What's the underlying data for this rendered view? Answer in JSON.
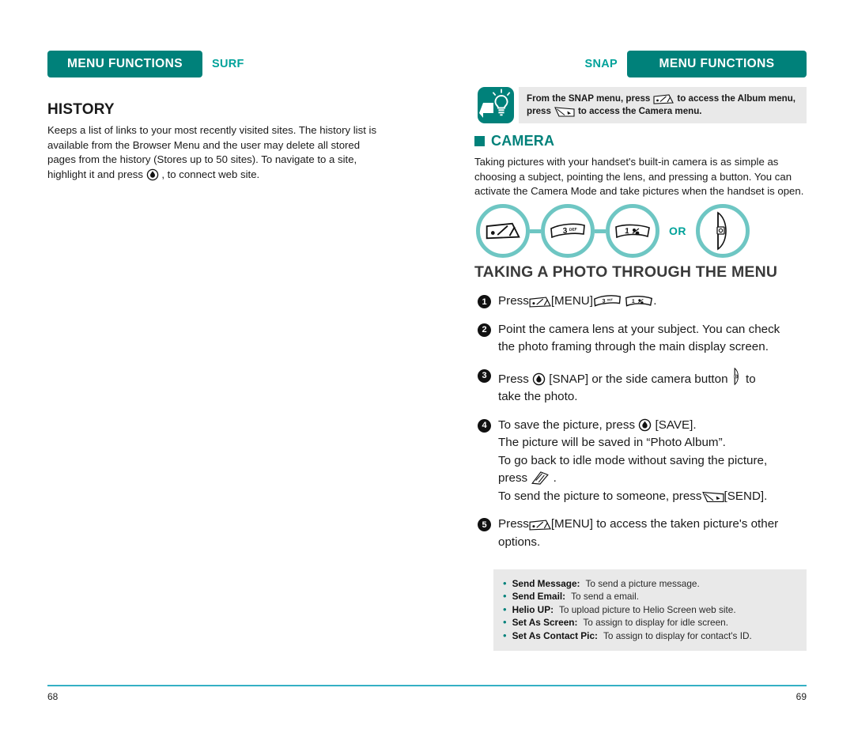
{
  "colors": {
    "teal_dark": "#00817a",
    "teal_mid": "#00a29a",
    "teal_ring": "#6ec6c3",
    "rule": "#35b0c4",
    "box_gray": "#e9e9e9",
    "text": "#1a1a1a"
  },
  "left_page": {
    "badge": "MENU FUNCTIONS",
    "section_tag": "SURF",
    "heading": "HISTORY",
    "body": "Keeps a list of links to your most recently visited sites. The history list is available from the Browser Menu and the user may delete all stored pages from the history (Stores up to 50 sites). To navigate to a site, highlight it and press",
    "body_tail": ", to connect web site.",
    "page_number": "68"
  },
  "right_page": {
    "badge": "MENU FUNCTIONS",
    "section_tag": "SNAP",
    "page_number": "69",
    "tip": {
      "icon": "lightbulb-tip-icon",
      "line1_a": "From the SNAP menu, press",
      "line1_b": "to access the Album menu,",
      "line2_a": "press",
      "line2_b": "to access the Camera menu."
    },
    "camera_heading": "CAMERA",
    "camera_intro": "Taking pictures with your handset's built-in camera is as simple as choosing a subject, pointing the lens, and pressing a button. You can activate the Camera Mode and take pictures when the handset is open.",
    "circles": [
      {
        "icon": "menu-softkey-icon"
      },
      {
        "icon": "key-3-def-icon",
        "label": "3",
        "sub": "DEF"
      },
      {
        "icon": "key-1-icon",
        "label": "1"
      },
      {
        "icon": "phone-side-camera-button-icon"
      }
    ],
    "or_label": "OR",
    "steps_heading": "TAKING A PHOTO THROUGH THE MENU",
    "steps": [
      {
        "num": "1",
        "lines": [
          {
            "parts": [
              {
                "t": "text",
                "v": "Press"
              },
              {
                "t": "icon",
                "v": "menu-softkey-icon"
              },
              {
                "t": "text",
                "v": "[MENU]"
              },
              {
                "t": "icon",
                "v": "key-3-def-icon"
              },
              {
                "t": "icon",
                "v": "key-1-icon"
              },
              {
                "t": "text",
                "v": "."
              }
            ]
          }
        ]
      },
      {
        "num": "2",
        "lines": [
          {
            "parts": [
              {
                "t": "text",
                "v": "Point the camera lens at your subject. You can check"
              }
            ]
          },
          {
            "parts": [
              {
                "t": "text",
                "v": "the photo framing through the main display screen."
              }
            ]
          }
        ]
      },
      {
        "num": "3",
        "lines": [
          {
            "parts": [
              {
                "t": "text",
                "v": "Press"
              },
              {
                "t": "icon",
                "v": "ok-key-icon"
              },
              {
                "t": "text",
                "v": "[SNAP] or the side camera button"
              },
              {
                "t": "icon",
                "v": "side-camera-button-icon"
              },
              {
                "t": "text",
                "v": "to"
              }
            ]
          },
          {
            "parts": [
              {
                "t": "text",
                "v": "take the photo."
              }
            ]
          }
        ]
      },
      {
        "num": "4",
        "lines": [
          {
            "parts": [
              {
                "t": "text",
                "v": "To save the picture, press"
              },
              {
                "t": "icon",
                "v": "ok-key-icon"
              },
              {
                "t": "text",
                "v": "[SAVE]."
              }
            ]
          },
          {
            "parts": [
              {
                "t": "text",
                "v": "The picture will be saved in “Photo Album”."
              }
            ]
          },
          {
            "parts": [
              {
                "t": "text",
                "v": "To go back to idle mode without saving the picture,"
              }
            ]
          },
          {
            "parts": [
              {
                "t": "text",
                "v": "press"
              },
              {
                "t": "icon",
                "v": "end-key-icon"
              },
              {
                "t": "text",
                "v": "."
              }
            ]
          },
          {
            "parts": [
              {
                "t": "text",
                "v": "To send the picture to someone, press"
              },
              {
                "t": "icon",
                "v": "send-key-icon"
              },
              {
                "t": "text",
                "v": "[SEND]."
              }
            ]
          }
        ]
      },
      {
        "num": "5",
        "lines": [
          {
            "parts": [
              {
                "t": "text",
                "v": "Press"
              },
              {
                "t": "icon",
                "v": "menu-softkey-icon"
              },
              {
                "t": "text",
                "v": "[MENU] to access the taken picture's other"
              }
            ]
          },
          {
            "parts": [
              {
                "t": "text",
                "v": "options."
              }
            ]
          }
        ]
      }
    ],
    "options": [
      {
        "name": "Send Message:",
        "desc": "To send a picture message."
      },
      {
        "name": "Send Email:",
        "desc": "To send a email."
      },
      {
        "name": "Helio UP:",
        "desc": "To upload picture to Helio Screen web site."
      },
      {
        "name": "Set As Screen:",
        "desc": "To assign to display for idle screen."
      },
      {
        "name": "Set As Contact Pic:",
        "desc": "To assign to display for contact's ID."
      }
    ]
  }
}
